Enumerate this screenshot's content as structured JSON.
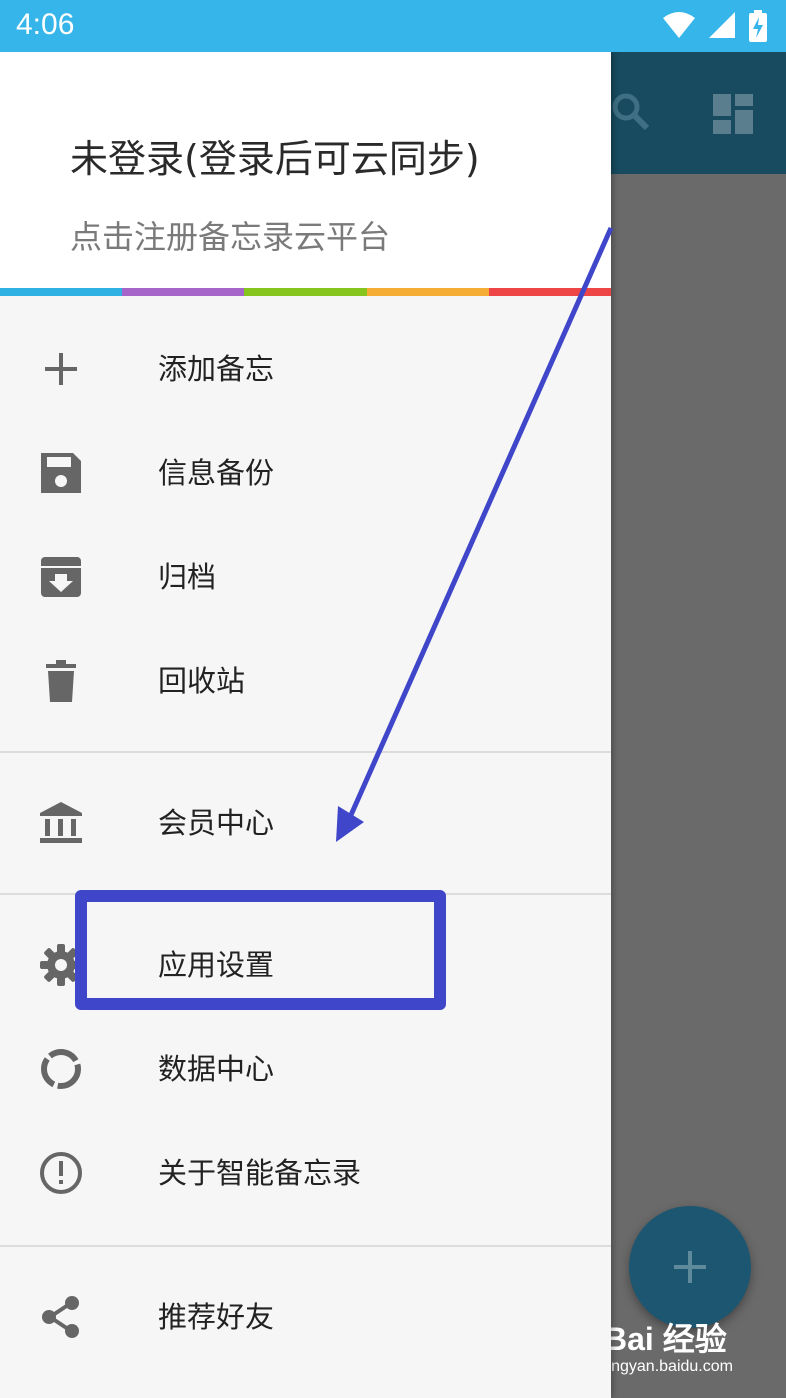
{
  "status_bar": {
    "time": "4:06"
  },
  "drawer": {
    "header": {
      "title": "未登录(登录后可云同步)",
      "subtitle": "点击注册备忘录云平台"
    },
    "stripe_colors": [
      "#2fb1e3",
      "#a565c9",
      "#86c41e",
      "#f5ad35",
      "#ee4546"
    ],
    "items": [
      {
        "label": "添加备忘",
        "icon": "plus-icon"
      },
      {
        "label": "信息备份",
        "icon": "save-icon"
      },
      {
        "label": "归档",
        "icon": "archive-icon"
      },
      {
        "label": "回收站",
        "icon": "trash-icon"
      },
      {
        "label": "会员中心",
        "icon": "bank-icon"
      },
      {
        "label": "应用设置",
        "icon": "gear-icon"
      },
      {
        "label": "数据中心",
        "icon": "donut-icon"
      },
      {
        "label": "关于智能备忘录",
        "icon": "info-icon"
      },
      {
        "label": "推荐好友",
        "icon": "share-icon"
      }
    ]
  },
  "watermark": {
    "brand": "Bai 经验",
    "url": "jingyan.baidu.com"
  },
  "colors": {
    "status_bar": "#35b5e9",
    "app_bar": "#184b60",
    "fab": "#1d5670",
    "annotation": "#3f46c9"
  }
}
